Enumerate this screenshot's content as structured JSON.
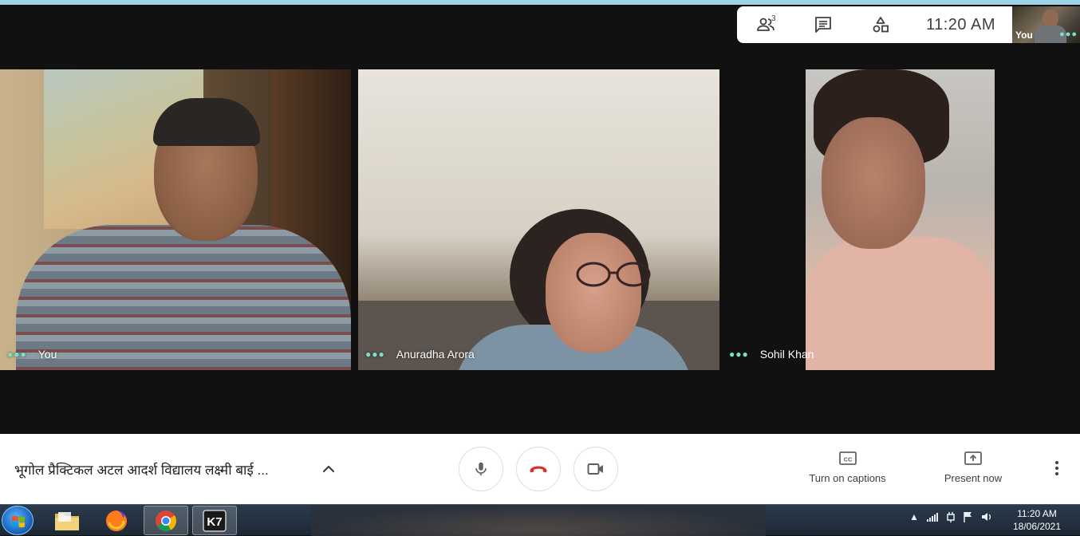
{
  "infobar": {
    "participants_count": "3",
    "time": "11:20  AM"
  },
  "self_view": {
    "label": "You"
  },
  "tiles": [
    {
      "name": "You"
    },
    {
      "name": "Anuradha Arora"
    },
    {
      "name": "Sohil Khan"
    }
  ],
  "controls": {
    "meeting_title": "भूगोल प्रैक्टिकल अटल आदर्श विद्यालय लक्ष्मी बाई ...",
    "captions_label": "Turn on captions",
    "present_label": "Present now"
  },
  "taskbar": {
    "apps": [
      "file-explorer",
      "firefox",
      "chrome",
      "k7"
    ],
    "clock_time": "11:20 AM",
    "clock_date": "18/06/2021"
  },
  "colors": {
    "accent_dots": "#7be0c8",
    "end_call": "#d93025",
    "top_strip": "#9fd3e6"
  }
}
